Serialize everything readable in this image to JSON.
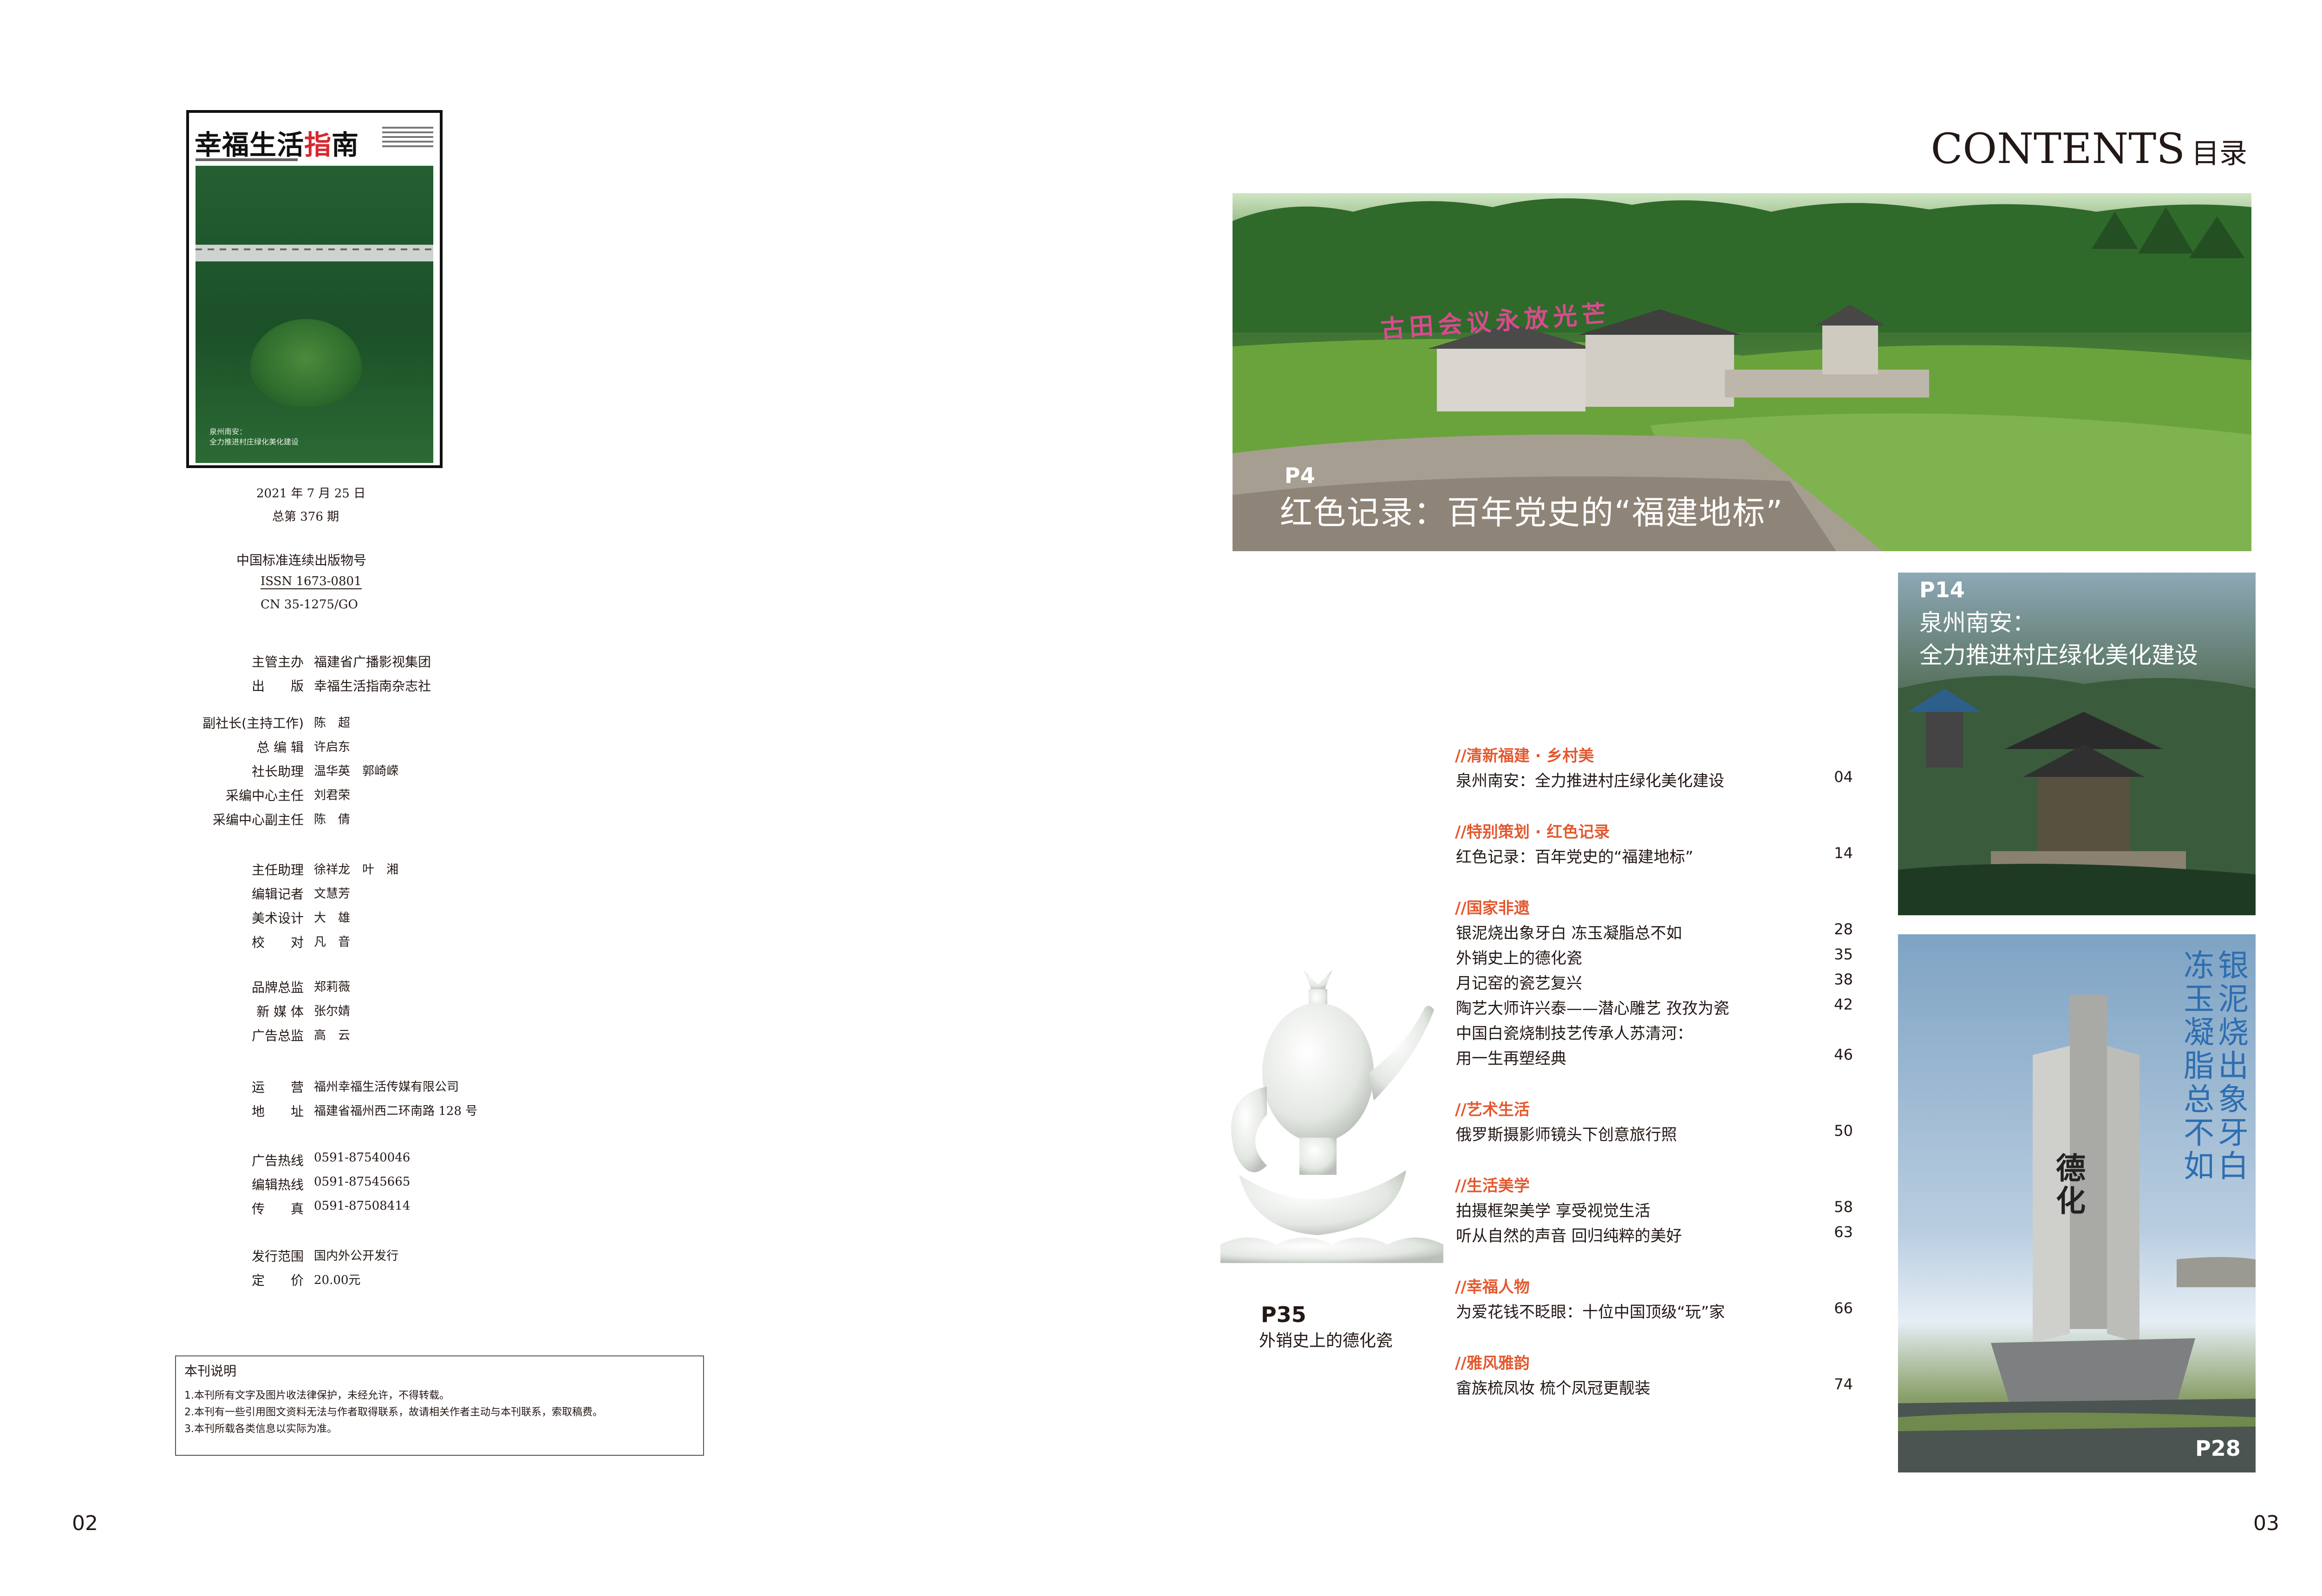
{
  "left_page": {
    "cover": {
      "logo_main": "幸福生活",
      "logo_accent": "指",
      "logo_end": "南",
      "caption_line1": "泉州南安：",
      "caption_line2": "全力推进村庄绿化美化建设"
    },
    "issue_date": "2021 年 7 月 25 日",
    "issue_number": "总第 376 期",
    "serial_label": "中国标准连续出版物号",
    "issn": "ISSN 1673-0801",
    "cn": "CN 35-1275/GO",
    "publisher": [
      {
        "label": "主管主办",
        "value": "福建省广播影视集团"
      },
      {
        "label": "出　　版",
        "value": "幸福生活指南杂志社"
      }
    ],
    "staff_group1": [
      {
        "label": "副社长(主持工作)",
        "value": "陈　超"
      },
      {
        "label": "总 编 辑",
        "value": "许启东"
      },
      {
        "label": "社长助理",
        "value": "温华英　郭崎嵘"
      },
      {
        "label": "采编中心主任",
        "value": "刘君荣"
      },
      {
        "label": "采编中心副主任",
        "value": "陈　倩"
      }
    ],
    "staff_group2": [
      {
        "label": "主任助理",
        "value": "徐祥龙　叶　湘"
      },
      {
        "label": "编辑记者",
        "value": "文慧芳"
      },
      {
        "label": "美术设计",
        "value": "大　雄"
      },
      {
        "label": "校　　对",
        "value": "凡　音"
      }
    ],
    "staff_group3": [
      {
        "label": "品牌总监",
        "value": "郑莉薇"
      },
      {
        "label": "新 媒 体",
        "value": "张尔婧"
      },
      {
        "label": "广告总监",
        "value": "高　云"
      }
    ],
    "operations": [
      {
        "label": "运　　营",
        "value": "福州幸福生活传媒有限公司"
      },
      {
        "label": "地　　址",
        "value": "福建省福州西二环南路 128 号"
      }
    ],
    "contacts": [
      {
        "label": "广告热线",
        "value": "0591-87540046"
      },
      {
        "label": "编辑热线",
        "value": "0591-87545665"
      },
      {
        "label": "传　　真",
        "value": "0591-87508414"
      }
    ],
    "distribution": [
      {
        "label": "发行范围",
        "value": "国内外公开发行"
      },
      {
        "label": "定　　价",
        "value": "20.00元"
      }
    ],
    "notice": {
      "title": "本刊说明",
      "lines": [
        "1.本刊所有文字及图片收法律保护，未经允许，不得转载。",
        "2.本刊有一些引用图文资料无法与作者取得联系，故请相关作者主动与本刊联系，索取稿费。",
        "3.本刊所载各类信息以实际为准。"
      ]
    },
    "page_number": "02"
  },
  "right_page": {
    "contents_title": "CONTENTS",
    "contents_cn": "目录",
    "feature_main": {
      "page_label": "P4",
      "title": "红色记录：百年党史的“福建地标”",
      "sign_text": "古田会议永放光芒"
    },
    "feature_p14": {
      "page_label": "P14",
      "line1": "泉州南安：",
      "line2": "全力推进村庄绿化美化建设"
    },
    "feature_p28": {
      "page_label": "P28",
      "vertical_col1": "银泥烧出象牙白",
      "vertical_col2": "冻玉凝脂总不如",
      "monument_text": "德化"
    },
    "feature_p35": {
      "page_label": "P35",
      "title": "外销史上的德化瓷"
    },
    "toc": [
      {
        "section": "//清新福建 · 乡村美",
        "items": [
          {
            "title": "泉州南安：全力推进村庄绿化美化建设",
            "page": "04"
          }
        ]
      },
      {
        "section": "//特别策划 · 红色记录",
        "items": [
          {
            "title": "红色记录：百年党史的“福建地标”",
            "page": "14"
          }
        ]
      },
      {
        "section": "//国家非遗",
        "items": [
          {
            "title": "银泥烧出象牙白  冻玉凝脂总不如",
            "page": "28"
          },
          {
            "title": "外销史上的德化瓷",
            "page": "35"
          },
          {
            "title": "月记窑的瓷艺复兴",
            "page": "38"
          },
          {
            "title": "陶艺大师许兴泰——潜心雕艺  孜孜为瓷",
            "page": "42"
          },
          {
            "title": "中国白瓷烧制技艺传承人苏清河：",
            "page": ""
          },
          {
            "title": "用一生再塑经典",
            "page": "46"
          }
        ]
      },
      {
        "section": "//艺术生活",
        "items": [
          {
            "title": "俄罗斯摄影师镜头下创意旅行照",
            "page": "50"
          }
        ]
      },
      {
        "section": "//生活美学",
        "items": [
          {
            "title": "拍摄框架美学  享受视觉生活",
            "page": "58"
          },
          {
            "title": "听从自然的声音  回归纯粹的美好",
            "page": "63"
          }
        ]
      },
      {
        "section": "//幸福人物",
        "items": [
          {
            "title": "为爱花钱不眨眼：十位中国顶级“玩”家",
            "page": "66"
          }
        ]
      },
      {
        "section": "//雅风雅韵",
        "items": [
          {
            "title": "畲族梳凤妆  梳个凤冠更靓装",
            "page": "74"
          }
        ]
      }
    ],
    "page_number": "03"
  }
}
